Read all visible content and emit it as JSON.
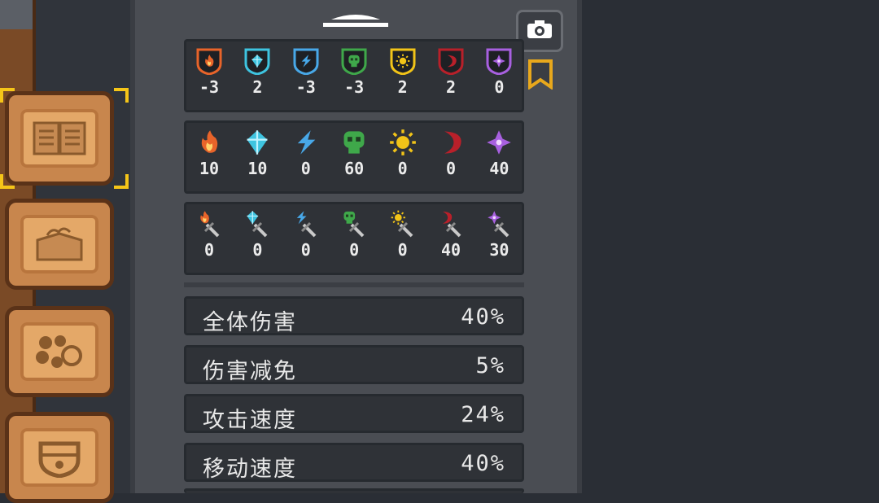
{
  "sidebar": {
    "tabs": [
      {
        "name": "codex",
        "icon": "book-icon",
        "selected": true
      },
      {
        "name": "materials",
        "icon": "box-icon",
        "selected": false
      },
      {
        "name": "gems",
        "icon": "gems-icon",
        "selected": false
      },
      {
        "name": "equipment",
        "icon": "shield-icon",
        "selected": false
      }
    ]
  },
  "panel": {
    "camera_icon": "camera-icon",
    "bookmark_icon": "bookmark-icon",
    "resistance": {
      "icons": [
        "fire-shield-icon",
        "ice-shield-icon",
        "lightning-shield-icon",
        "poison-shield-icon",
        "light-shield-icon",
        "dark-shield-icon",
        "arcane-shield-icon"
      ],
      "values": [
        "-3",
        "2",
        "-3",
        "-3",
        "2",
        "2",
        "0"
      ]
    },
    "element": {
      "icons": [
        "fire-icon",
        "ice-icon",
        "lightning-icon",
        "poison-icon",
        "light-icon",
        "dark-icon",
        "arcane-icon"
      ],
      "values": [
        "10",
        "10",
        "0",
        "60",
        "0",
        "0",
        "40"
      ]
    },
    "weapon_element": {
      "icons": [
        "fire-sword-icon",
        "ice-sword-icon",
        "lightning-sword-icon",
        "poison-sword-icon",
        "light-sword-icon",
        "dark-sword-icon",
        "arcane-sword-icon"
      ],
      "values": [
        "0",
        "0",
        "0",
        "0",
        "0",
        "40",
        "30"
      ]
    },
    "stats": [
      {
        "label": "全体伤害",
        "value": "40%"
      },
      {
        "label": "伤害减免",
        "value": "5%"
      },
      {
        "label": "攻击速度",
        "value": "24%"
      },
      {
        "label": "移动速度",
        "value": "40%"
      }
    ]
  },
  "colors": {
    "fire": "#e8642a",
    "ice": "#3ec4e0",
    "lightning": "#48a8e8",
    "poison": "#3fa84a",
    "light": "#f2c418",
    "dark": "#b8202a",
    "arcane": "#a860e0",
    "accent": "#f5c518"
  }
}
